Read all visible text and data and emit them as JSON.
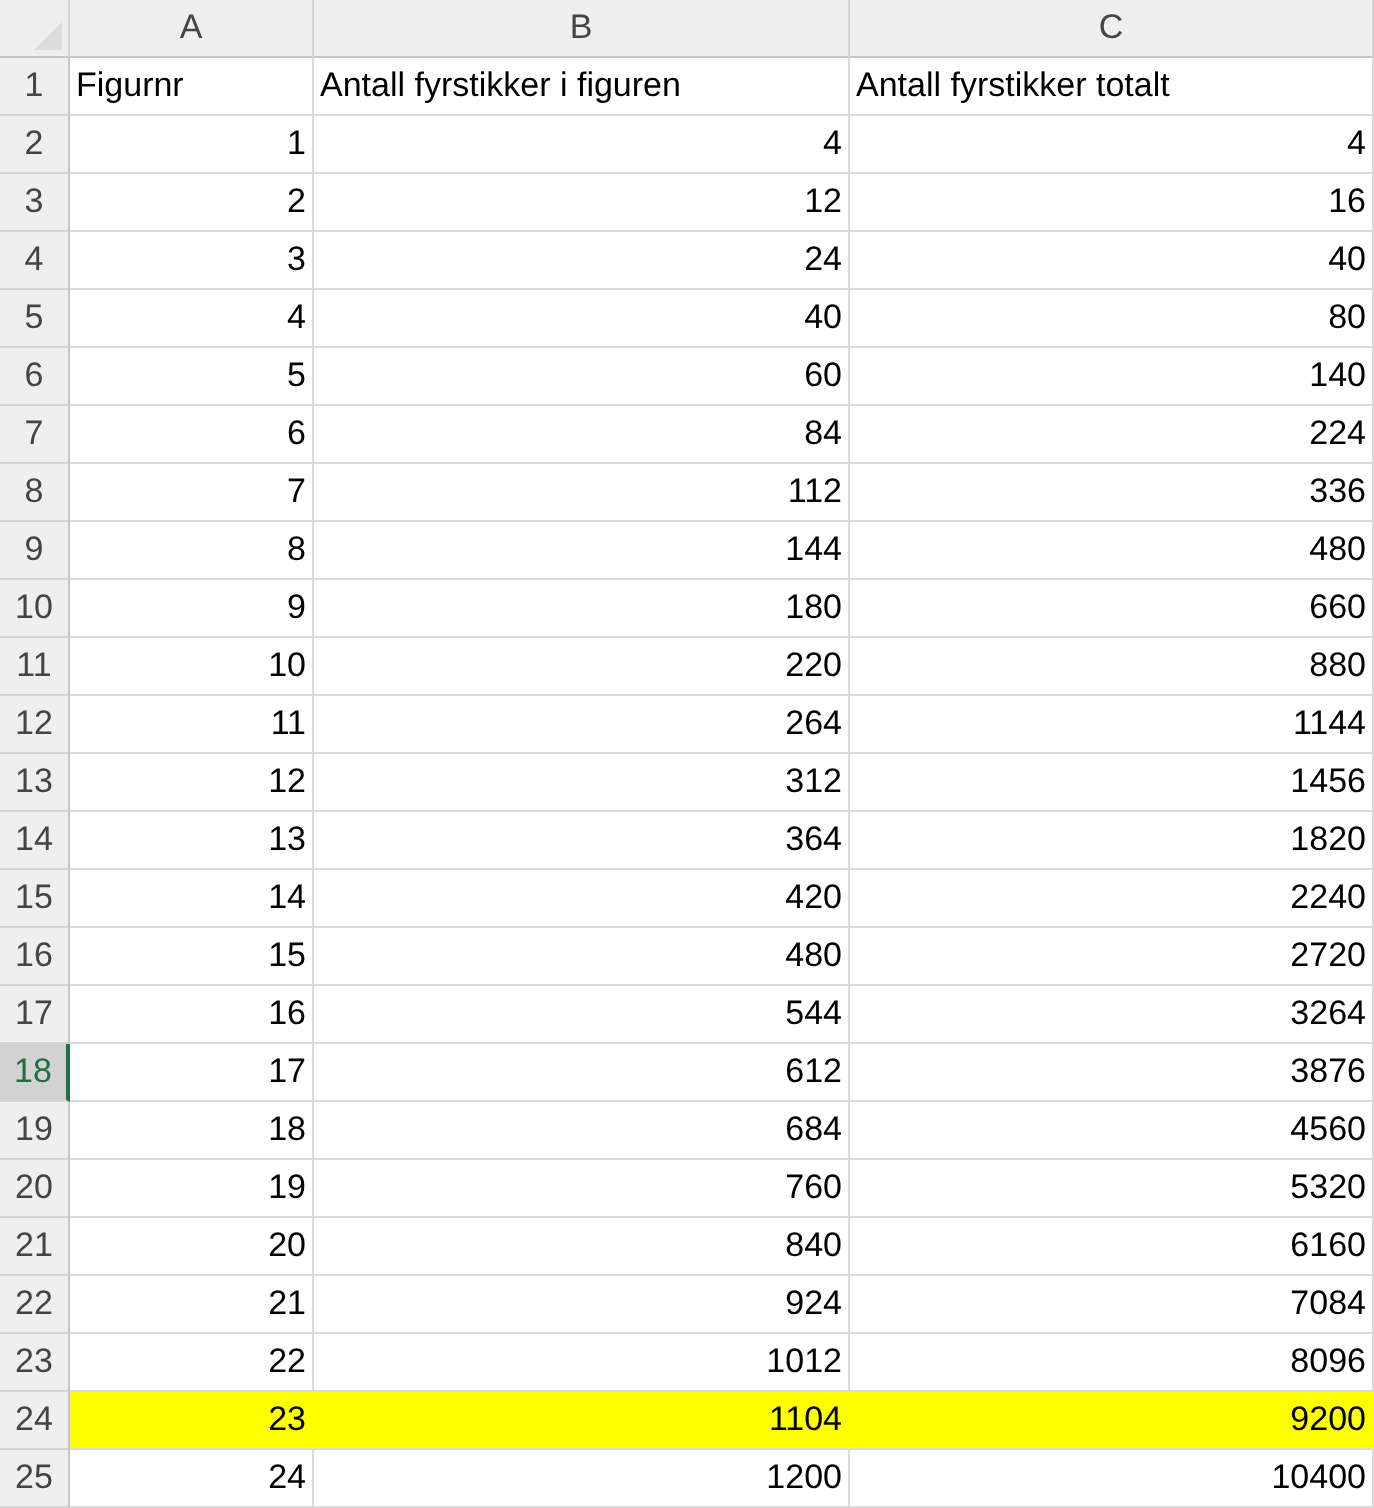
{
  "columns": [
    {
      "label": "A",
      "selected": false
    },
    {
      "label": "B",
      "selected": false
    },
    {
      "label": "C",
      "selected": false
    }
  ],
  "rows": [
    {
      "header": "1",
      "selected": false,
      "highlighted": false,
      "kind": "heading",
      "cells": [
        "Figurnr",
        "Antall fyrstikker i figuren",
        "Antall fyrstikker totalt"
      ]
    },
    {
      "header": "2",
      "selected": false,
      "highlighted": false,
      "kind": "data",
      "cells": [
        "1",
        "4",
        "4"
      ]
    },
    {
      "header": "3",
      "selected": false,
      "highlighted": false,
      "kind": "data",
      "cells": [
        "2",
        "12",
        "16"
      ]
    },
    {
      "header": "4",
      "selected": false,
      "highlighted": false,
      "kind": "data",
      "cells": [
        "3",
        "24",
        "40"
      ]
    },
    {
      "header": "5",
      "selected": false,
      "highlighted": false,
      "kind": "data",
      "cells": [
        "4",
        "40",
        "80"
      ]
    },
    {
      "header": "6",
      "selected": false,
      "highlighted": false,
      "kind": "data",
      "cells": [
        "5",
        "60",
        "140"
      ]
    },
    {
      "header": "7",
      "selected": false,
      "highlighted": false,
      "kind": "data",
      "cells": [
        "6",
        "84",
        "224"
      ]
    },
    {
      "header": "8",
      "selected": false,
      "highlighted": false,
      "kind": "data",
      "cells": [
        "7",
        "112",
        "336"
      ]
    },
    {
      "header": "9",
      "selected": false,
      "highlighted": false,
      "kind": "data",
      "cells": [
        "8",
        "144",
        "480"
      ]
    },
    {
      "header": "10",
      "selected": false,
      "highlighted": false,
      "kind": "data",
      "cells": [
        "9",
        "180",
        "660"
      ]
    },
    {
      "header": "11",
      "selected": false,
      "highlighted": false,
      "kind": "data",
      "cells": [
        "10",
        "220",
        "880"
      ]
    },
    {
      "header": "12",
      "selected": false,
      "highlighted": false,
      "kind": "data",
      "cells": [
        "11",
        "264",
        "1144"
      ]
    },
    {
      "header": "13",
      "selected": false,
      "highlighted": false,
      "kind": "data",
      "cells": [
        "12",
        "312",
        "1456"
      ]
    },
    {
      "header": "14",
      "selected": false,
      "highlighted": false,
      "kind": "data",
      "cells": [
        "13",
        "364",
        "1820"
      ]
    },
    {
      "header": "15",
      "selected": false,
      "highlighted": false,
      "kind": "data",
      "cells": [
        "14",
        "420",
        "2240"
      ]
    },
    {
      "header": "16",
      "selected": false,
      "highlighted": false,
      "kind": "data",
      "cells": [
        "15",
        "480",
        "2720"
      ]
    },
    {
      "header": "17",
      "selected": false,
      "highlighted": false,
      "kind": "data",
      "cells": [
        "16",
        "544",
        "3264"
      ]
    },
    {
      "header": "18",
      "selected": true,
      "highlighted": false,
      "kind": "data",
      "cells": [
        "17",
        "612",
        "3876"
      ]
    },
    {
      "header": "19",
      "selected": false,
      "highlighted": false,
      "kind": "data",
      "cells": [
        "18",
        "684",
        "4560"
      ]
    },
    {
      "header": "20",
      "selected": false,
      "highlighted": false,
      "kind": "data",
      "cells": [
        "19",
        "760",
        "5320"
      ]
    },
    {
      "header": "21",
      "selected": false,
      "highlighted": false,
      "kind": "data",
      "cells": [
        "20",
        "840",
        "6160"
      ]
    },
    {
      "header": "22",
      "selected": false,
      "highlighted": false,
      "kind": "data",
      "cells": [
        "21",
        "924",
        "7084"
      ]
    },
    {
      "header": "23",
      "selected": false,
      "highlighted": false,
      "kind": "data",
      "cells": [
        "22",
        "1012",
        "8096"
      ]
    },
    {
      "header": "24",
      "selected": false,
      "highlighted": true,
      "kind": "data",
      "cells": [
        "23",
        "1104",
        "9200"
      ]
    },
    {
      "header": "25",
      "selected": false,
      "highlighted": false,
      "kind": "data",
      "cells": [
        "24",
        "1200",
        "10400"
      ]
    }
  ]
}
